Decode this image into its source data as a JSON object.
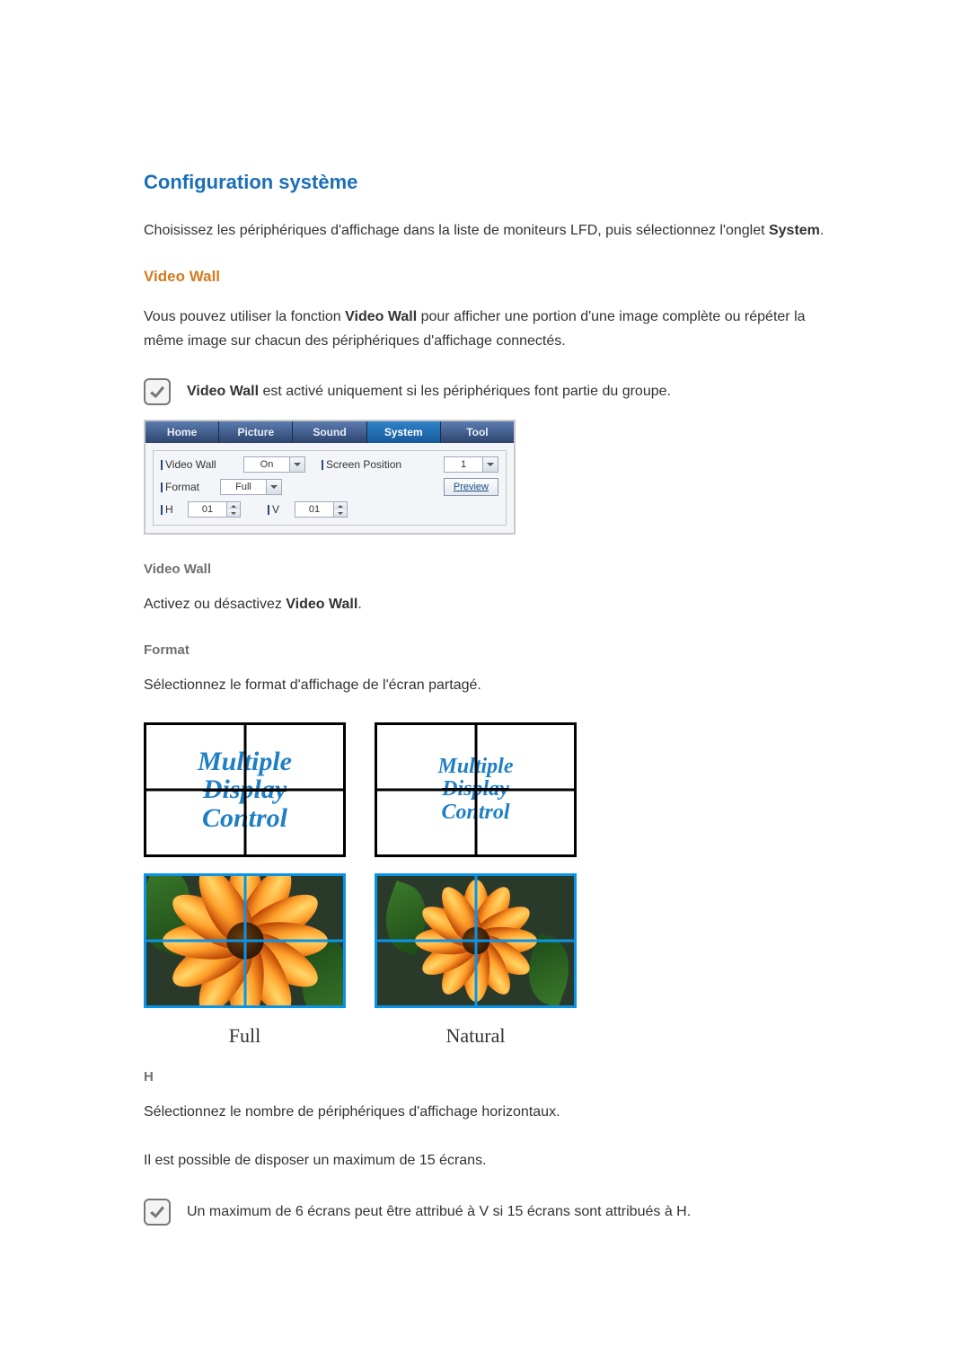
{
  "section": {
    "title": "Configuration système",
    "intro_pre": "Choisissez les périphériques d'affichage dans la liste de moniteurs LFD, puis sélectionnez l'onglet ",
    "intro_bold": "System",
    "intro_post": "."
  },
  "videowall": {
    "heading": "Video Wall",
    "desc_pre": "Vous pouvez utiliser la fonction ",
    "desc_bold": "Video Wall",
    "desc_post": " pour afficher une portion d'une image complète ou répéter la même image sur chacun des périphériques d'affichage connectés.",
    "note_pre_bold": "Video Wall",
    "note_post": " est activé uniquement si les périphériques font partie du groupe."
  },
  "panel": {
    "tabs": [
      "Home",
      "Picture",
      "Sound",
      "System",
      "Tool"
    ],
    "active_tab": "System",
    "row1": {
      "label_videowall": "Video Wall",
      "value_videowall": "On",
      "label_screenpos": "Screen Position",
      "value_screenpos": "1"
    },
    "row2": {
      "label_format": "Format",
      "value_format": "Full",
      "preview_btn": "Preview"
    },
    "row3": {
      "label_h": "H",
      "value_h": "01",
      "label_v": "V",
      "value_v": "01"
    }
  },
  "sub_videowall": {
    "title": "Video Wall",
    "desc_pre": "Activez ou désactivez ",
    "desc_bold": "Video Wall",
    "desc_post": "."
  },
  "sub_format": {
    "title": "Format",
    "desc": "Sélectionnez le format d'affichage de l'écran partagé.",
    "mdc_lines": [
      "Multiple",
      "Display",
      "Control"
    ],
    "label_full": "Full",
    "label_natural": "Natural"
  },
  "sub_h": {
    "title": "H",
    "desc": "Sélectionnez le nombre de périphériques d'affichage horizontaux.",
    "limit": "Il est possible de disposer un maximum de 15 écrans.",
    "note": "Un maximum de 6 écrans peut être attribué à V si 15 écrans sont attribués à H."
  }
}
